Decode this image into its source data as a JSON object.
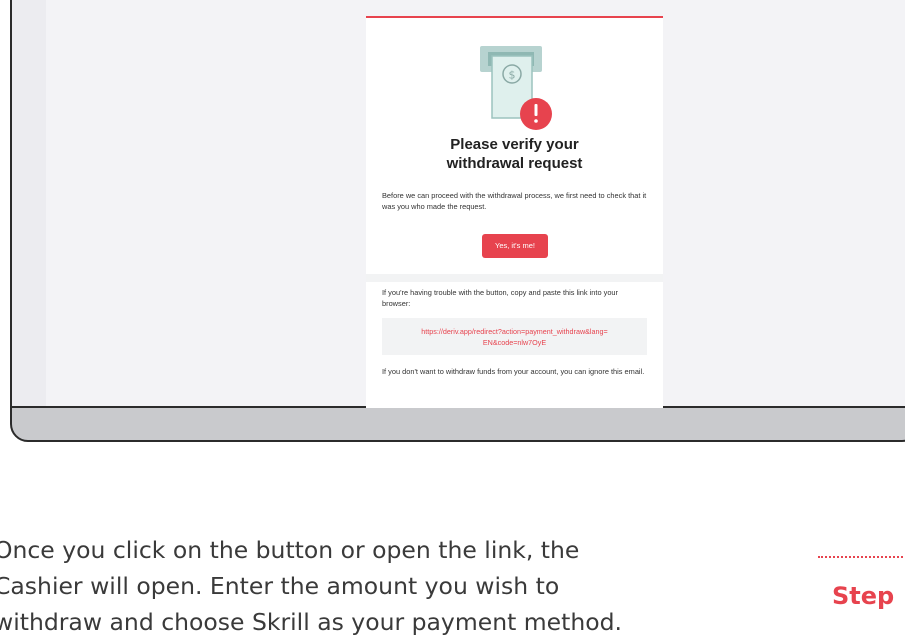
{
  "email": {
    "title_line1": "Please verify your",
    "title_line2": "withdrawal request",
    "body": "Before we can proceed with the withdrawal process, we first need to check that it was you who made the request.",
    "button_label": "Yes, it's me!",
    "trouble_text": "If you're having trouble with the button, copy and paste this link into your browser:",
    "link_line1": "https://deriv.app/redirect?action=payment_withdraw&lang=",
    "link_line2": "EN&code=nlw7OyE",
    "ignore_text": "If you don't want to withdraw funds from your account, you can ignore this email."
  },
  "caption": {
    "line1": "Once you click on the button or open the link, the",
    "line2": "Cashier will open. Enter the amount you wish to",
    "line3": "withdraw and choose Skrill as your payment method."
  },
  "step": {
    "label": "Step"
  },
  "colors": {
    "accent": "#e7434e",
    "frame": "#2b2b2b"
  },
  "icons": {
    "illustration": "cash-withdraw-alert-icon"
  }
}
